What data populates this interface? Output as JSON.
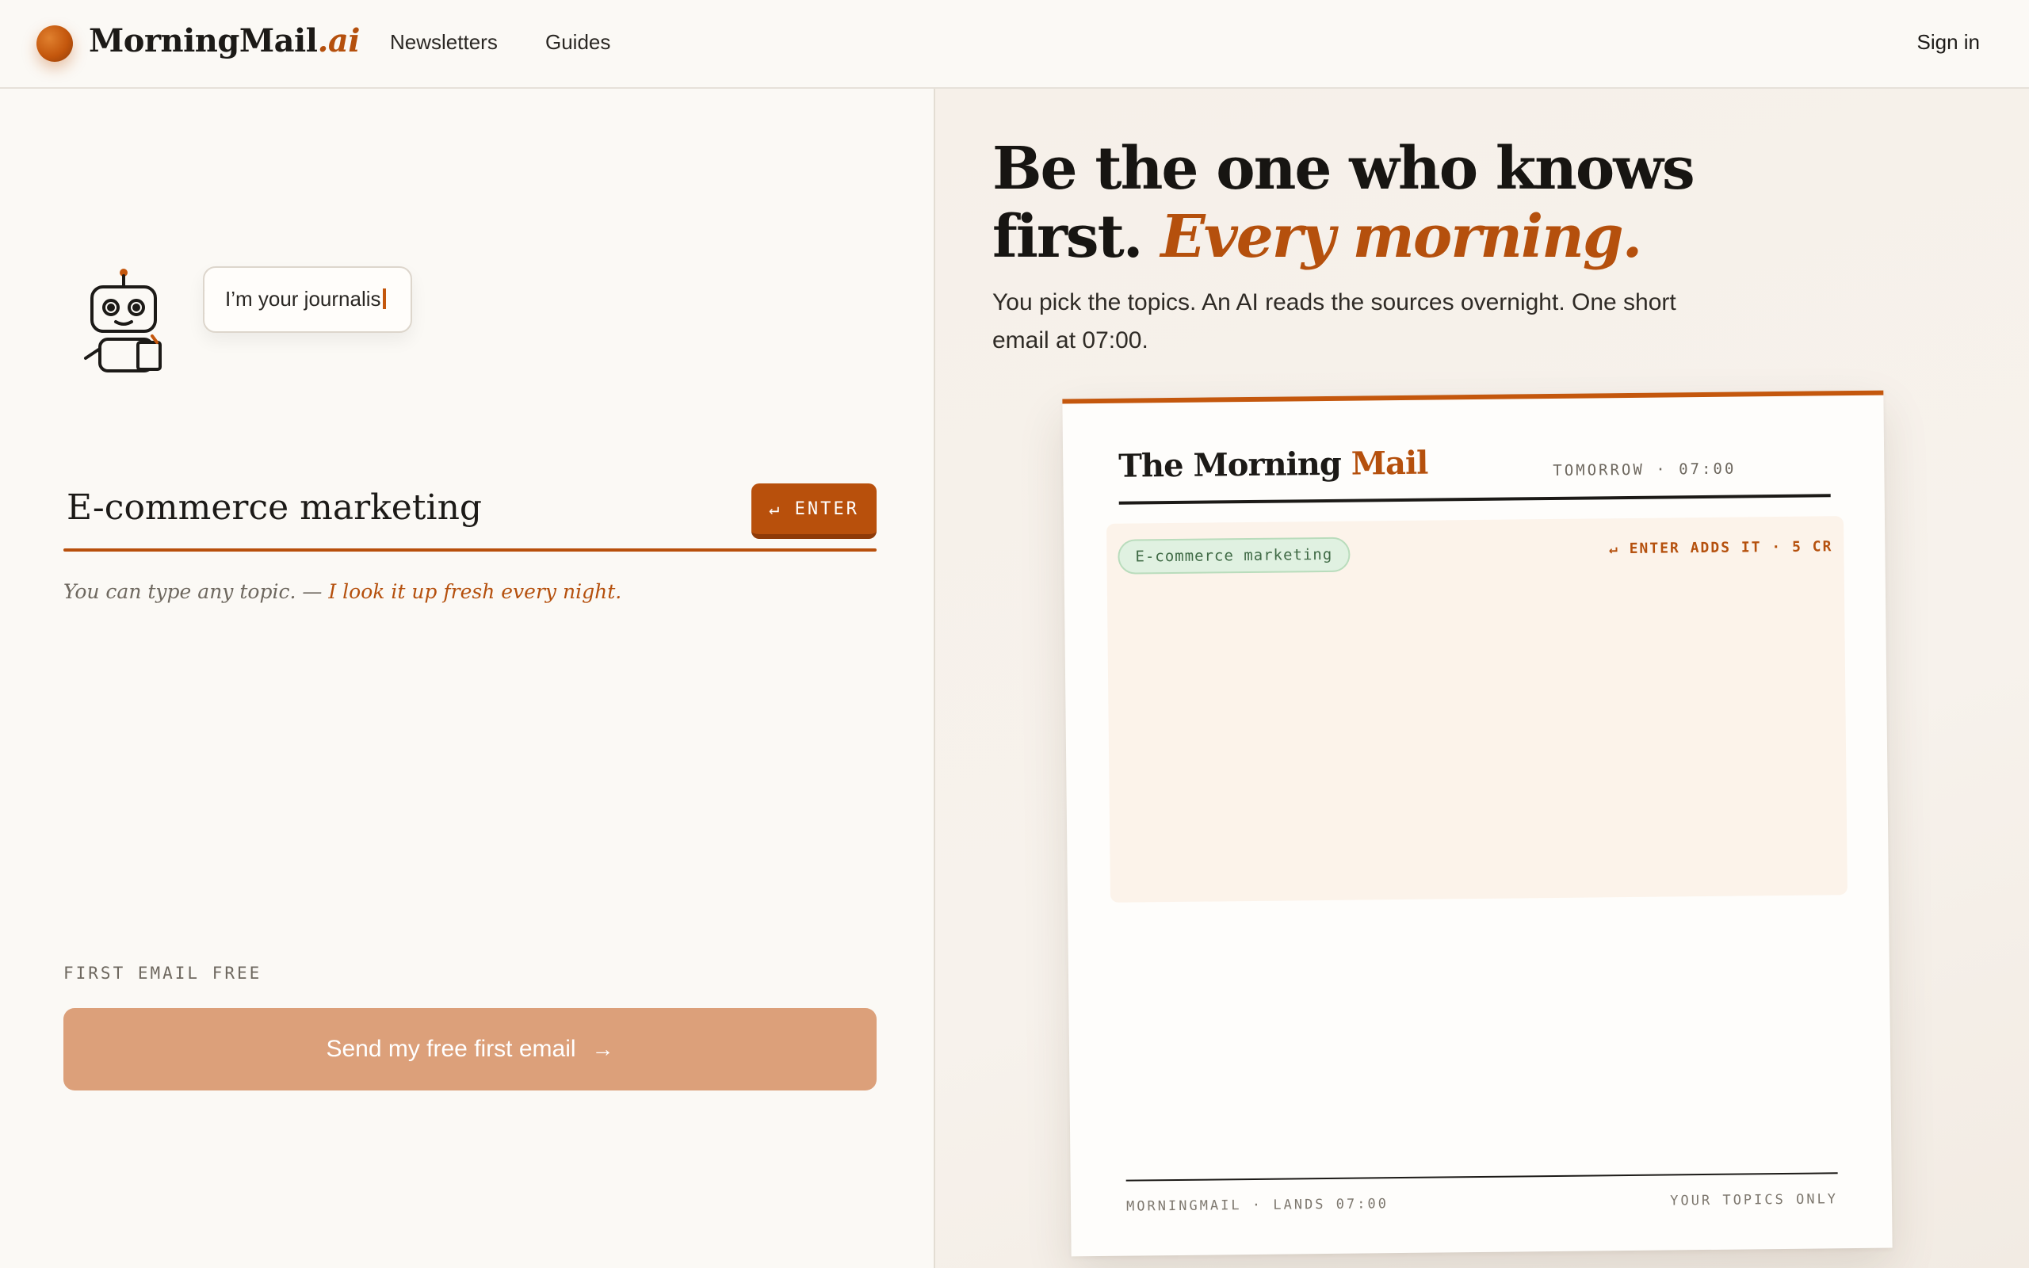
{
  "header": {
    "brand_main": "MorningMail",
    "brand_suffix": ".ai",
    "nav": [
      "Newsletters",
      "Guides"
    ],
    "sign_in": "Sign in"
  },
  "left": {
    "bubble_text": "I’m your journalis",
    "topic_value": "E-commerce marketing",
    "enter_label": "↵ ENTER",
    "hint_prefix": "You can type any topic. — ",
    "hint_accent": "I look it up fresh every night.",
    "first_free_label": "FIRST EMAIL FREE",
    "send_label": "Send my free first email",
    "send_arrow": "→"
  },
  "right": {
    "headline_line1": "Be the one who knows",
    "headline_line2_plain": "first. ",
    "headline_line2_accent": "Every morning.",
    "subtext": "You pick the topics. An AI reads the sources overnight. One short email at 07:00."
  },
  "card": {
    "title_plain": "The Morning ",
    "title_accent": "Mail",
    "when": "TOMORROW · 07:00",
    "chip": "E-commerce marketing",
    "enter_adds": "↵ ENTER ADDS IT · 5 CR",
    "footer_left": "MORNINGMAIL · LANDS 07:00",
    "footer_right": "YOUR TOPICS ONLY"
  },
  "colors": {
    "accent": "#b5500d",
    "button_disabled": "#dca07a",
    "background": "#fbf9f5",
    "chip_bg": "#e0f1e1"
  },
  "icons": {
    "logo": "orange-sphere-logo",
    "mascot": "robot-mascot-icon",
    "enter": "return-arrow-icon",
    "send": "arrow-right-icon"
  }
}
